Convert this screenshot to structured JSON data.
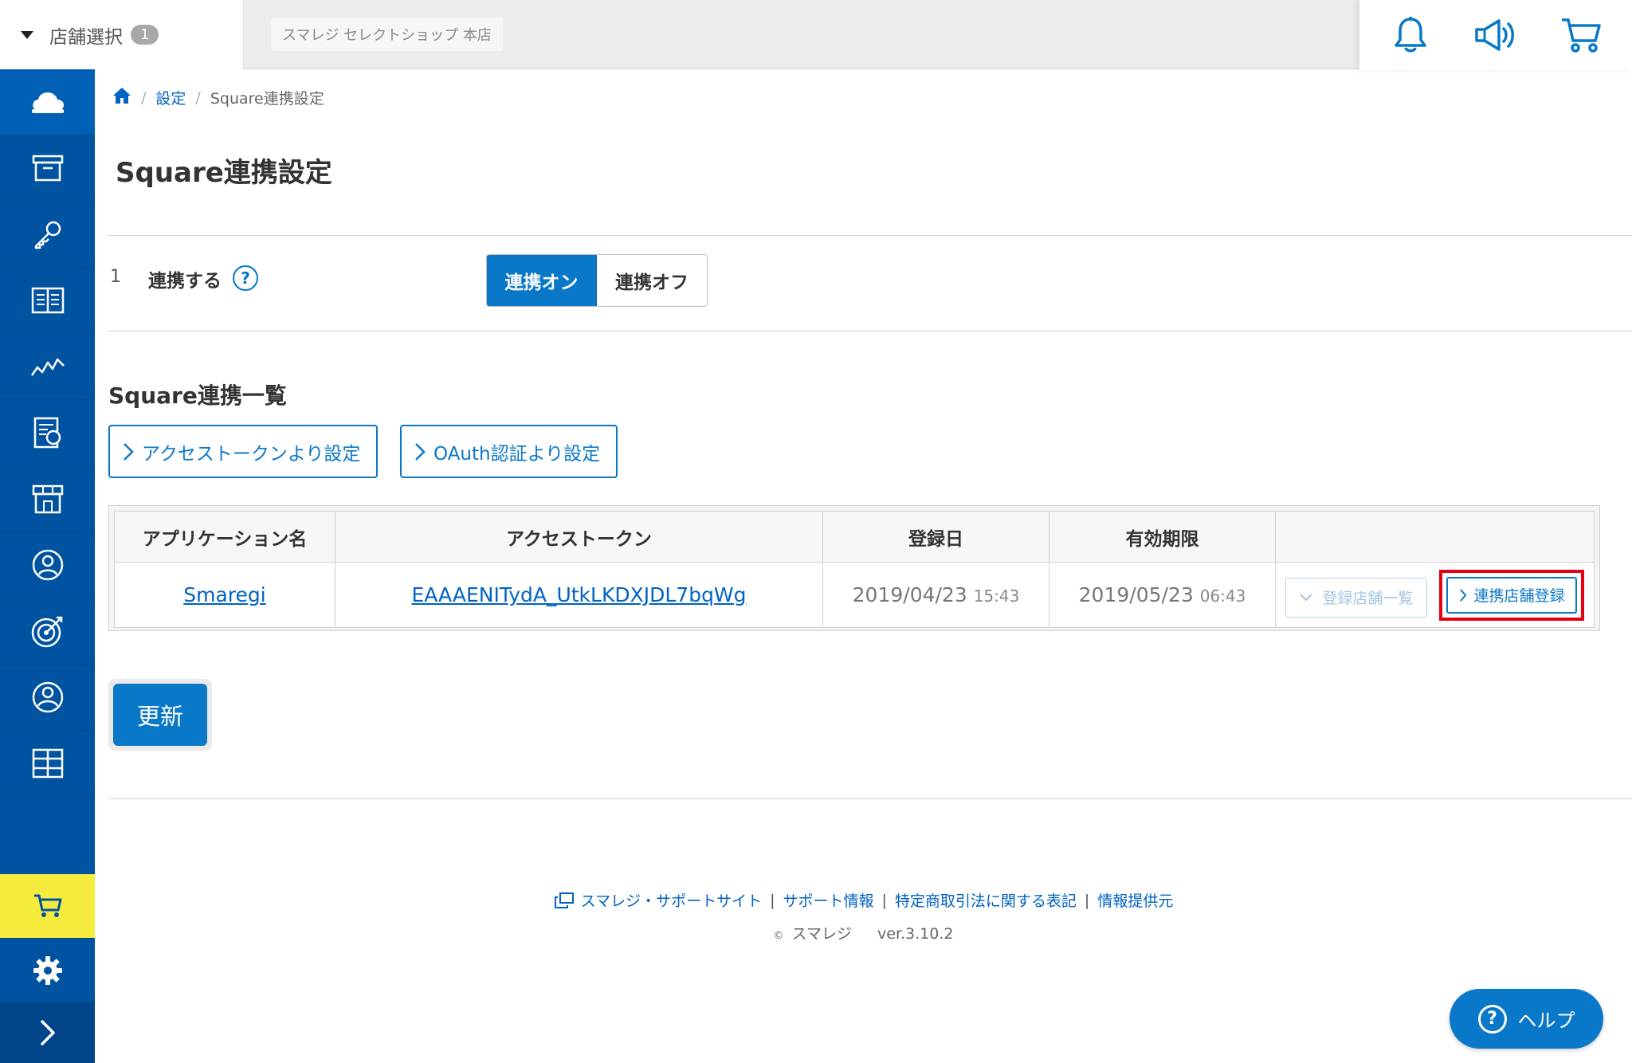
{
  "topbar": {
    "store_select_label": "店舗選択",
    "store_count": "1",
    "shop_name": "スマレジ セレクトショップ 本店",
    "icons": [
      "bell-icon",
      "megaphone-icon",
      "cart-icon"
    ]
  },
  "sidebar": {
    "items": [
      "cloud-icon",
      "archive-icon",
      "key-icon",
      "book-icon",
      "chart-icon",
      "report-icon",
      "store-icon",
      "customer-icon",
      "target-icon",
      "user-icon",
      "grid-icon"
    ],
    "bottom": [
      "cart-icon",
      "gear-icon",
      "expand-icon"
    ],
    "cart_highlight": "#f5ec3e"
  },
  "breadcrumb": {
    "settings": "設定",
    "current": "Square連携設定"
  },
  "page": {
    "title": "Square連携設定"
  },
  "setting": {
    "number": "1",
    "label": "連携する",
    "help": "?",
    "toggle_on": "連携オン",
    "toggle_off": "連携オフ"
  },
  "list": {
    "title": "Square連携一覧",
    "btn_access_token": "アクセストークンより設定",
    "btn_oauth": "OAuth認証より設定"
  },
  "table": {
    "headers": [
      "アプリケーション名",
      "アクセストークン",
      "登録日",
      "有効期限",
      ""
    ],
    "rows": [
      {
        "app_name": "Smaregi",
        "access_token": "EAAAENITydA_UtkLKDXJDL7bqWg",
        "registered_date": "2019/04/23",
        "registered_time": "15:43",
        "expiry_date": "2019/05/23",
        "expiry_time": "06:43",
        "btn_store_list": "登録店舗一覧",
        "btn_store_register": "連携店舗登録"
      }
    ]
  },
  "update_button": "更新",
  "footer": {
    "support_site": "スマレジ・サポートサイト",
    "support_info": "サポート情報",
    "legal": "特定商取引法に関する表記",
    "provider": "情報提供元",
    "copyright": "©",
    "company": "スマレジ",
    "version": "ver.3.10.2"
  },
  "help_button": "ヘルプ",
  "colors": {
    "primary": "#0a78c9",
    "sidebar": "#0053a0",
    "highlight_box": "#e60012"
  }
}
